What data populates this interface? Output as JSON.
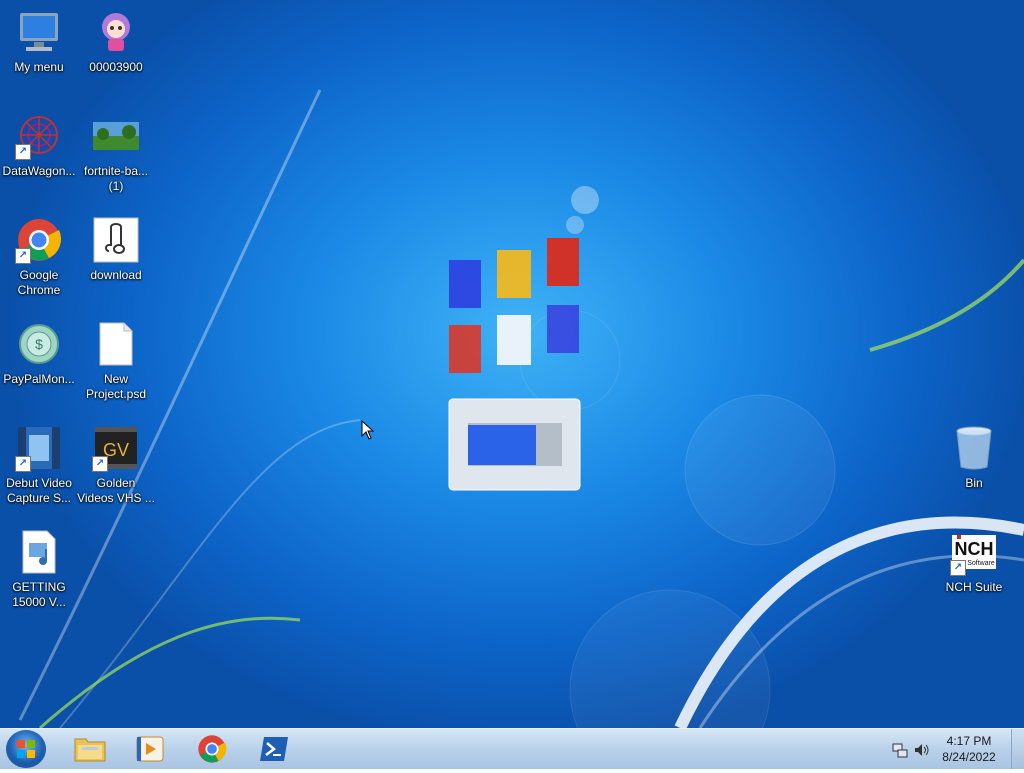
{
  "desktop": {
    "icons_left": [
      {
        "label": "My menu",
        "icon": "computer-icon"
      },
      {
        "label": "00003900",
        "icon": "cartoon-character-icon"
      },
      {
        "label": "DataWagon...",
        "icon": "datawagon-icon",
        "shortcut": true
      },
      {
        "label": "fortnite-ba... (1)",
        "icon": "image-thumbnail-icon"
      },
      {
        "label": "Google Chrome",
        "icon": "chrome-icon",
        "shortcut": true
      },
      {
        "label": "download",
        "icon": "audio-file-icon"
      },
      {
        "label": "PayPalMon...",
        "icon": "paypal-money-icon"
      },
      {
        "label": "New Project.psd",
        "icon": "blank-file-icon"
      },
      {
        "label": "Debut Video Capture S...",
        "icon": "debut-video-icon",
        "shortcut": true
      },
      {
        "label": "Golden Videos VHS ...",
        "icon": "golden-videos-icon",
        "shortcut": true
      },
      {
        "label": "GETTING 15000 V...",
        "icon": "media-file-icon"
      }
    ],
    "icons_right": [
      {
        "label": "Bin",
        "icon": "recycle-bin-icon"
      },
      {
        "label": "NCH Suite",
        "icon": "nch-suite-icon",
        "shortcut": true
      }
    ],
    "nch_logo_text": "NCH",
    "nch_logo_sub": "Software",
    "golden_logo_text": "GV"
  },
  "taskbar": {
    "pinned": [
      {
        "name": "file-explorer-icon"
      },
      {
        "name": "media-player-icon"
      },
      {
        "name": "chrome-icon"
      },
      {
        "name": "powershell-icon"
      }
    ],
    "clock_time": "4:17 PM",
    "clock_date": "8/24/2022"
  },
  "colors": {
    "desktop_center": "#3fb2f6",
    "desktop_edge": "#0a4fa8",
    "taskbar": "#b9d1ea"
  }
}
